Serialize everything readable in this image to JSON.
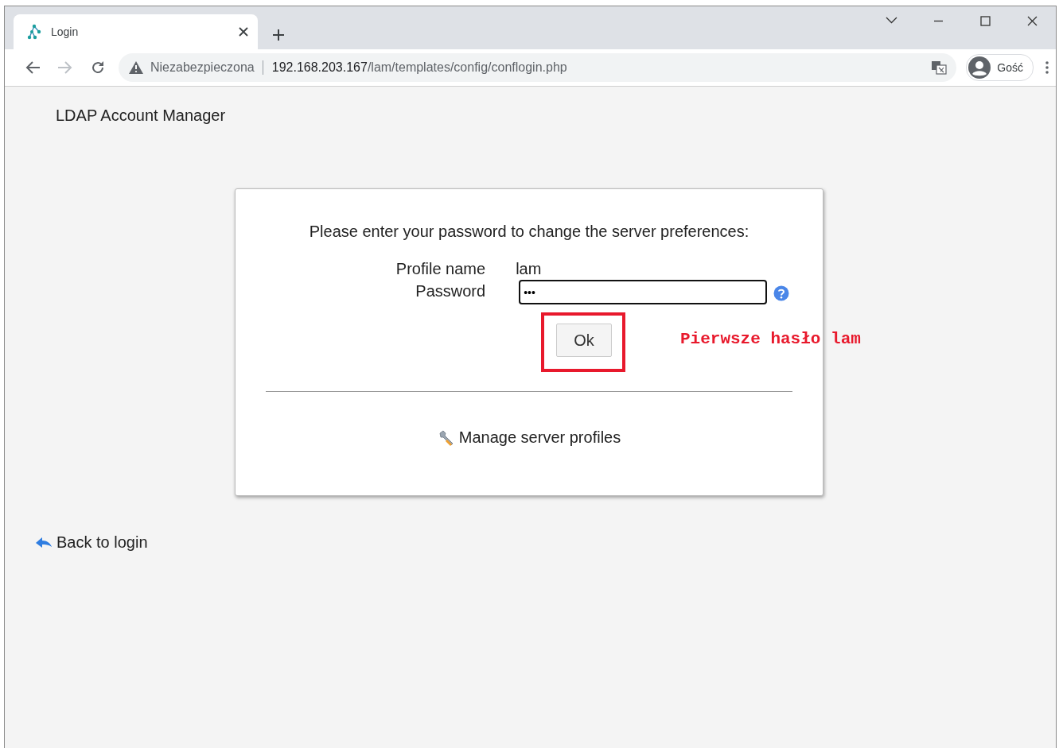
{
  "browser": {
    "tab": {
      "title": "Login",
      "selected": true
    },
    "address": {
      "security": "Niezabezpieczona",
      "host": "192.168.203.167",
      "path": "/lam/templates/config/conflogin.php"
    },
    "profile": "Gość"
  },
  "page": {
    "header": "LDAP Account Manager",
    "dialog": {
      "prompt": "Please enter your password to change the server preferences:",
      "profile_label": "Profile name",
      "profile_value": "lam",
      "password_label": "Password",
      "password_value": "•••",
      "ok_button": "Ok",
      "manage_link": "Manage server profiles"
    },
    "back_link": "Back to login"
  },
  "annotation": {
    "note": "Pierwsze hasło lam",
    "highlight_ok": true
  }
}
